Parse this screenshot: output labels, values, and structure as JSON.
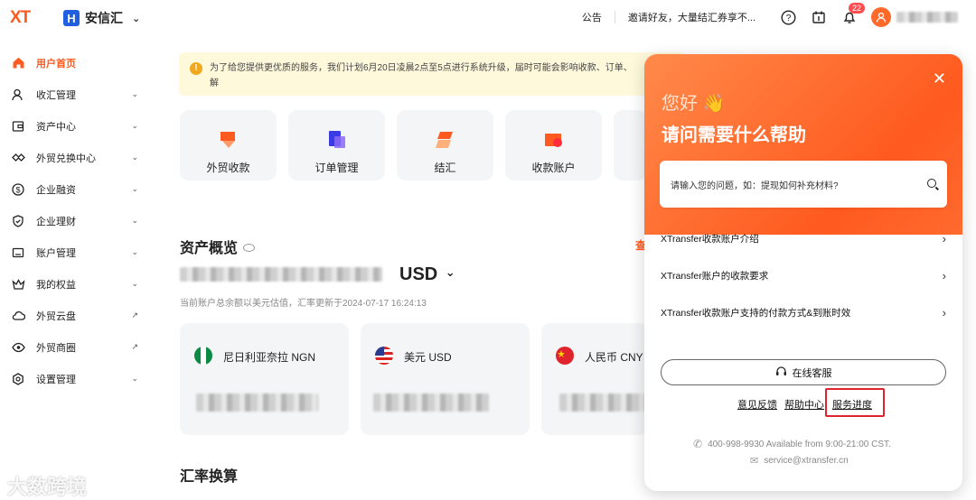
{
  "header": {
    "logo": "XT",
    "brand": "安信汇",
    "brand_mark": "H",
    "announcement": "公告",
    "invite": "邀请好友，大量结汇券享不...",
    "notification_count": "22"
  },
  "sidebar": {
    "items": [
      {
        "label": "用户首页",
        "icon": "home-icon",
        "active": true
      },
      {
        "label": "收汇管理",
        "icon": "user-icon",
        "arrow": "⌄"
      },
      {
        "label": "资产中心",
        "icon": "wallet-icon",
        "arrow": "⌄"
      },
      {
        "label": "外贸兑换中心",
        "icon": "exchange-icon",
        "arrow": "⌄"
      },
      {
        "label": "企业融资",
        "icon": "dollar-icon",
        "arrow": "⌄"
      },
      {
        "label": "企业理财",
        "icon": "shield-icon",
        "arrow": "⌄"
      },
      {
        "label": "账户管理",
        "icon": "account-icon",
        "arrow": "⌄"
      },
      {
        "label": "我的权益",
        "icon": "crown-icon",
        "arrow": "⌄"
      },
      {
        "label": "外贸云盘",
        "icon": "cloud-icon",
        "arrow": "↗"
      },
      {
        "label": "外贸商圈",
        "icon": "eye-icon",
        "arrow": "↗"
      },
      {
        "label": "设置管理",
        "icon": "settings-icon",
        "arrow": "⌄"
      }
    ]
  },
  "notice": {
    "text": "为了给您提供更优质的服务，我们计划6月20日凌晨2点至5点进行系统升级，届时可能会影响收款、订单、",
    "text2": "解"
  },
  "quick_cards": [
    {
      "label": "外贸收款"
    },
    {
      "label": "订单管理"
    },
    {
      "label": "结汇"
    },
    {
      "label": "收款账户"
    }
  ],
  "assets": {
    "title": "资产概览",
    "currency": "USD",
    "note": "当前账户总余额以美元估值，汇率更新于2024-07-17 16:24:13",
    "view_link": "查"
  },
  "accounts": [
    {
      "name": "尼日利亚奈拉 NGN"
    },
    {
      "name": "美元 USD"
    },
    {
      "name": "人民币 CNY"
    }
  ],
  "rate_title": "汇率换算",
  "help": {
    "hello": "您好 👋",
    "title": "请问需要什么帮助",
    "search_placeholder": "请输入您的问题，如：提现如何补充材料?",
    "faqs": [
      "XTransfer收款账户介绍",
      "XTransfer账户的收款要求",
      "XTransfer收款账户支持的付款方式&到账时效"
    ],
    "online_service": "在线客服",
    "feedback": "意见反馈",
    "help_center": "帮助中心",
    "service_progress": "服务进度",
    "phone": "400-998-9930 Available from 9:00-21:00 CST.",
    "email": "service@xtransfer.cn"
  },
  "watermark": "大数跨境",
  "colors": {
    "brand": "#ff5a1f",
    "highlight": "#e0242d"
  }
}
